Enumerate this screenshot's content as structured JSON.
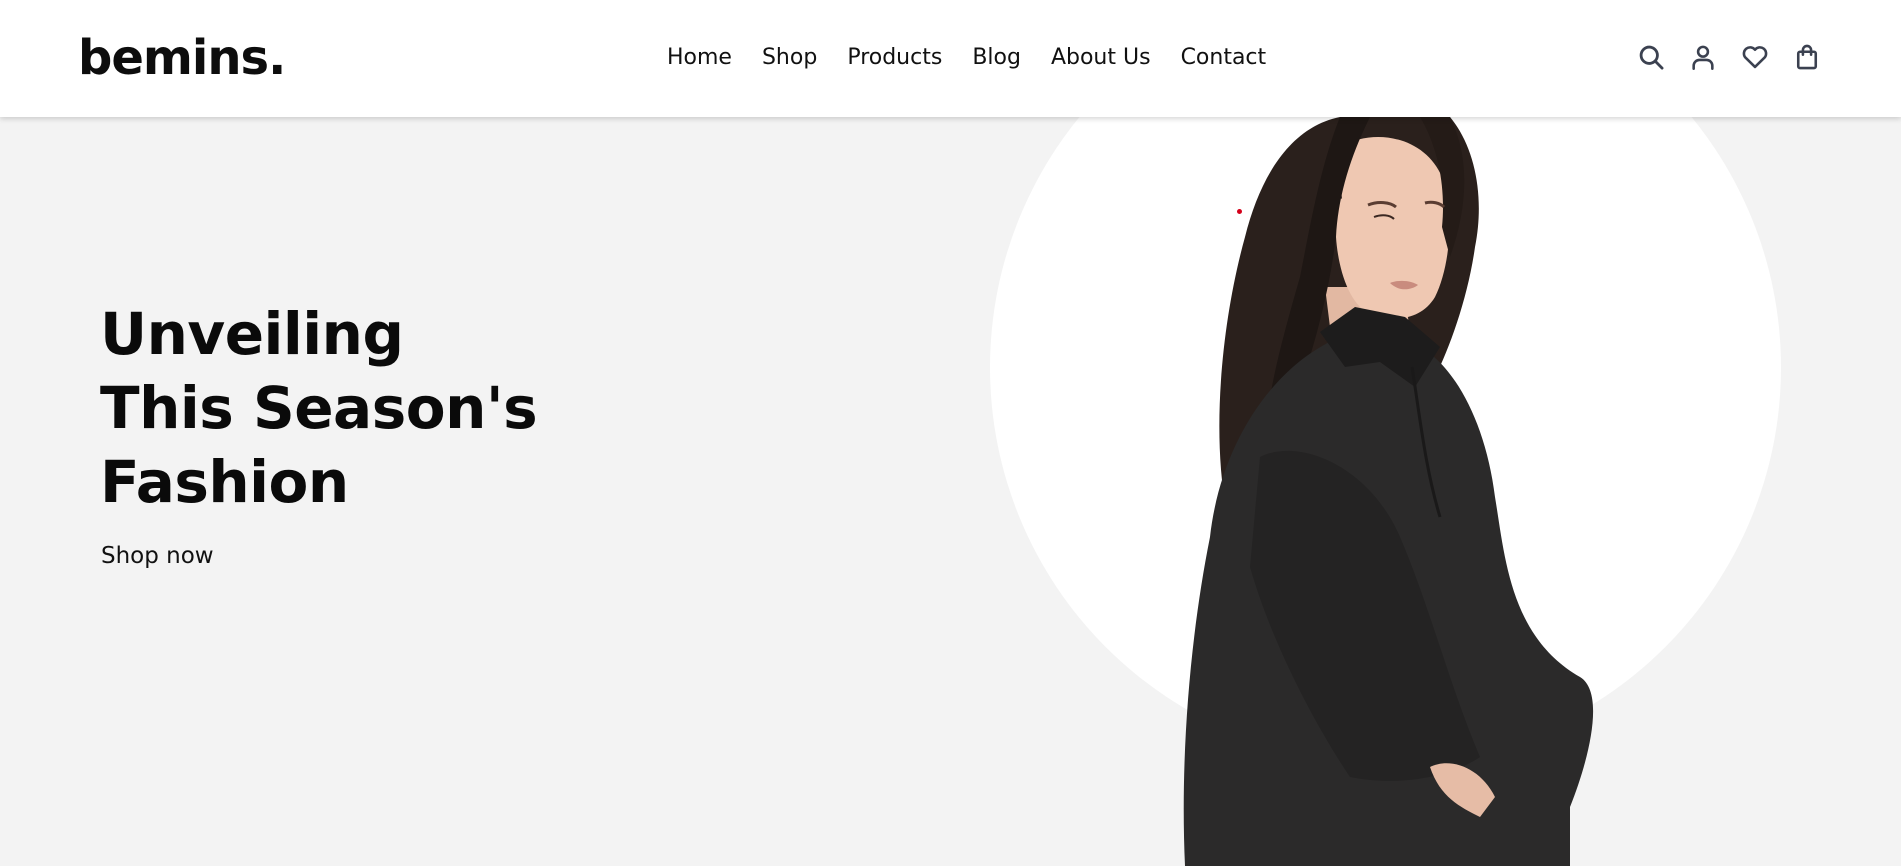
{
  "brand": {
    "logo_text": "bemins."
  },
  "nav": {
    "items": [
      {
        "label": "Home"
      },
      {
        "label": "Shop"
      },
      {
        "label": "Products"
      },
      {
        "label": "Blog"
      },
      {
        "label": "About Us"
      },
      {
        "label": "Contact"
      }
    ]
  },
  "header_icons": [
    "search-icon",
    "user-icon",
    "heart-icon",
    "shopping-bag-icon"
  ],
  "hero": {
    "title_lines": [
      "Unveiling",
      "This Season's",
      "Fashion"
    ],
    "cta_label": "Shop now",
    "image_alt": "Model wearing a black oversized shirt dress"
  },
  "colors": {
    "header_bg": "#ffffff",
    "hero_bg": "#f3f3f3",
    "circle": "#ffffff",
    "text": "#111111",
    "icon_stroke": "#3b4150",
    "accent_dot": "#d4001a"
  }
}
